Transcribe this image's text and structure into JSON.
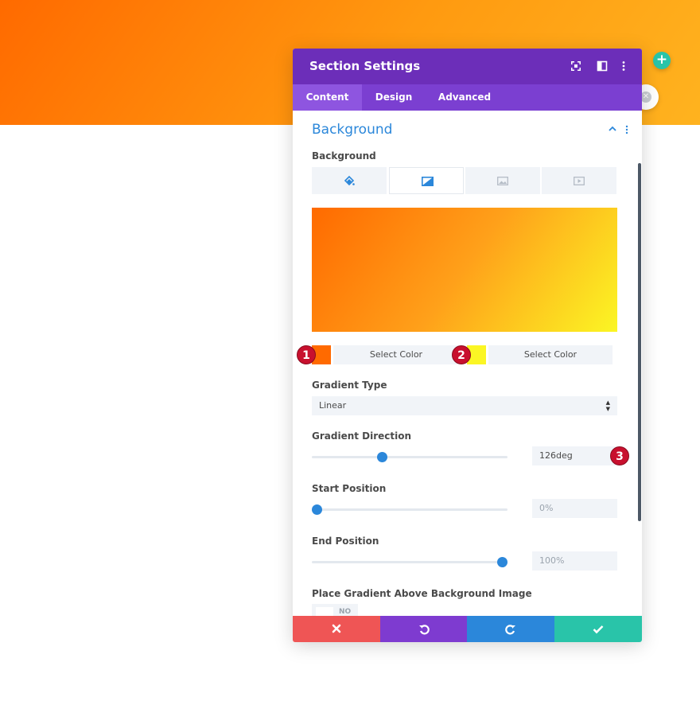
{
  "modal": {
    "title": "Section Settings",
    "tabs": [
      {
        "label": "Content",
        "active": true
      },
      {
        "label": "Design",
        "active": false
      },
      {
        "label": "Advanced",
        "active": false
      }
    ]
  },
  "section": {
    "title": "Background",
    "background_label": "Background",
    "bg_tabs": [
      "paint-bucket-icon",
      "gradient-icon",
      "image-icon",
      "video-icon"
    ],
    "active_bg_tab": "gradient-icon"
  },
  "gradient": {
    "color1": "#ff6a00",
    "color2": "#fbf624",
    "stop1_label": "Select Color",
    "stop2_label": "Select Color",
    "badges": [
      "1",
      "2",
      "3"
    ],
    "type_label": "Gradient Type",
    "type_value": "Linear",
    "direction_label": "Gradient Direction",
    "direction_value": "126deg",
    "direction_fraction": 0.35,
    "start_label": "Start Position",
    "start_value": "0%",
    "start_fraction": 0.0,
    "end_label": "End Position",
    "end_value": "100%",
    "end_fraction": 1.0,
    "place_above_label": "Place Gradient Above Background Image",
    "place_above_value": "NO"
  },
  "colors": {
    "header": "#6c2eb9",
    "tabs": "#7b3fd1",
    "accent": "#2b87da",
    "cancel": "#ef5555",
    "undo": "#7e3bd0",
    "redo": "#2b87da",
    "save": "#29c4a9"
  }
}
